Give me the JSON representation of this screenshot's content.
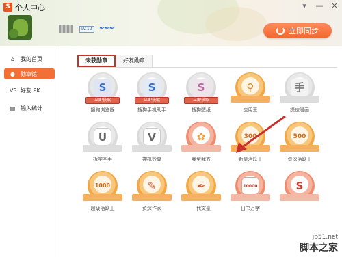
{
  "window": {
    "title": "个人中心",
    "logo": "S",
    "controls": [
      "▾",
      "—",
      "✕"
    ]
  },
  "profile": {
    "level": "LV.12",
    "pens": "✒✒✒"
  },
  "sync_button": {
    "label": "立即同步"
  },
  "sidebar": {
    "items": [
      {
        "label": "我的首页",
        "icon": "⌂"
      },
      {
        "label": "勋章馆",
        "icon": "●"
      },
      {
        "label": "好友 PK",
        "icon": "VS"
      },
      {
        "label": "输入统计",
        "icon": "▤"
      }
    ]
  },
  "tabs": [
    {
      "label": "未获勋章"
    },
    {
      "label": "好友勋章"
    }
  ],
  "badges": [
    {
      "label": "搜狗浏览器",
      "glyph": "S",
      "obtain": "立即获取"
    },
    {
      "label": "搜狗手机助手",
      "glyph": "S",
      "obtain": "立即获取"
    },
    {
      "label": "搜狗壁纸",
      "glyph": "S",
      "obtain": "立即获取"
    },
    {
      "label": "应用王",
      "glyph": "⚲"
    },
    {
      "label": "提速漫画",
      "glyph": "手"
    },
    {
      "label": "拆字圣手",
      "glyph": "U"
    },
    {
      "label": "神机妙算",
      "glyph": "V"
    },
    {
      "label": "我型我秀",
      "glyph": "✿"
    },
    {
      "label": "新星活跃王",
      "glyph": "300"
    },
    {
      "label": "资深活跃王",
      "glyph": "500"
    },
    {
      "label": "超级活跃王",
      "glyph": "1000"
    },
    {
      "label": "资深作家",
      "glyph": "✎"
    },
    {
      "label": "一代文豪",
      "glyph": "✒"
    },
    {
      "label": "日书万字",
      "glyph": "10000"
    },
    {
      "label": "",
      "glyph": "S"
    }
  ],
  "watermark": {
    "line1": "jb51.net",
    "line2": "脚本之家"
  }
}
